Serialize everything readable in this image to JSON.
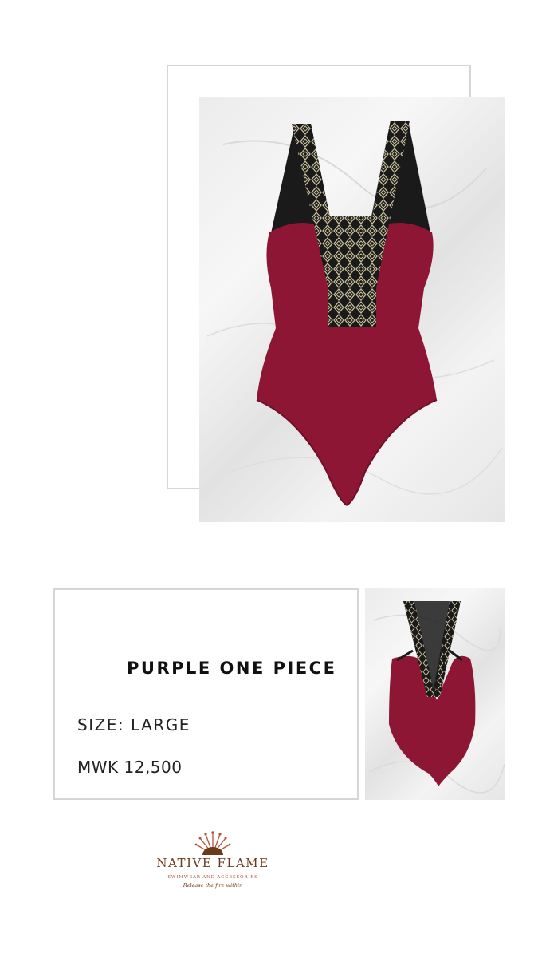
{
  "product": {
    "title": "PURPLE ONE PIECE",
    "size": "SIZE: LARGE",
    "price": "MWK 12,500"
  },
  "brand": {
    "name": "NATIVE FLAME",
    "subtitle": "- SWIMWEAR AND ACCESSORIES -",
    "tagline": "Release the fire within"
  },
  "colors": {
    "swimsuit": "#8e1635",
    "trim": "#1a1a1a",
    "trim_pattern": "#c9c09a",
    "logo": "#6b3a1c",
    "logo_accent": "#b0573a",
    "frame_border": "#d6d6d6"
  }
}
